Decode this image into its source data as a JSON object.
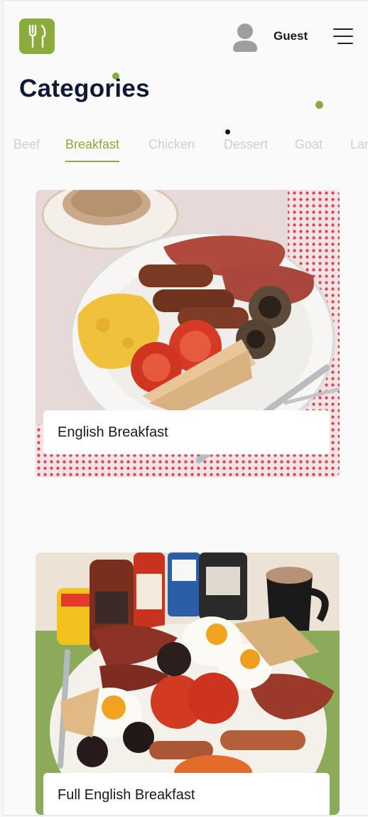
{
  "header": {
    "user_name": "Guest"
  },
  "page": {
    "title": "Categories"
  },
  "tabs": [
    {
      "label": "Beef",
      "active": false
    },
    {
      "label": "Breakfast",
      "active": true
    },
    {
      "label": "Chicken",
      "active": false
    },
    {
      "label": "Dessert",
      "active": false
    },
    {
      "label": "Goat",
      "active": false
    },
    {
      "label": "Lamb",
      "active": false
    }
  ],
  "meals": [
    {
      "name": "English Breakfast"
    },
    {
      "name": "Full English Breakfast"
    }
  ],
  "colors": {
    "accent": "#8aac3b",
    "title": "#0e1a33",
    "inactive_tab": "#cfcfcf"
  }
}
